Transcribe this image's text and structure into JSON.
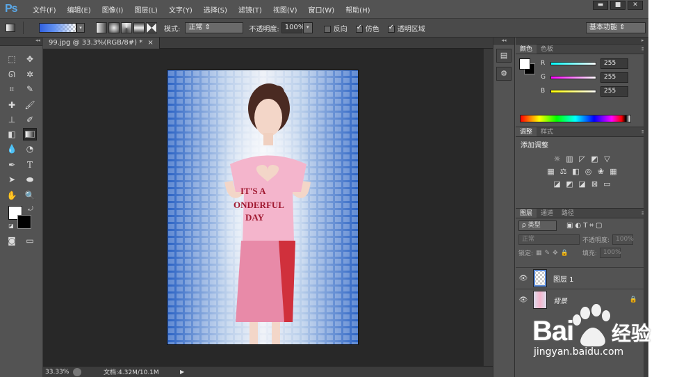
{
  "app": {
    "logo": "Ps"
  },
  "menu": [
    "文件(F)",
    "编辑(E)",
    "图像(I)",
    "图层(L)",
    "文字(Y)",
    "选择(S)",
    "滤镜(T)",
    "视图(V)",
    "窗口(W)",
    "帮助(H)"
  ],
  "window_controls": {
    "minimize": "▬",
    "maximize": "■",
    "close": "✕"
  },
  "options": {
    "mode_label": "模式:",
    "mode_value": "正常",
    "opacity_label": "不透明度:",
    "opacity_value": "100%",
    "reverse_label": "反向",
    "dither_label": "仿色",
    "transparency_label": "透明区域",
    "reverse_checked": false,
    "dither_checked": true,
    "transparency_checked": true,
    "workspace": "基本功能"
  },
  "document": {
    "tab_title": "99.jpg @ 33.3%(RGB/8#) *",
    "tab_close": "×",
    "zoom": "33.33%",
    "doc_info": "文档:4.32M/10.1M",
    "shirt_text": "IT'S A\nONDERFUL\nDAY"
  },
  "panels": {
    "color_tabs": [
      "颜色",
      "色板"
    ],
    "color": {
      "r_label": "R",
      "g_label": "G",
      "b_label": "B",
      "r": "255",
      "g": "255",
      "b": "255"
    },
    "adjust_tabs": [
      "调整",
      "样式"
    ],
    "adjust_title": "添加调整",
    "layers_tabs": [
      "图层",
      "通道",
      "路径"
    ],
    "layer_filter": "ρ 类型",
    "blend_mode": "正常",
    "opacity_label": "不透明度:",
    "opacity_value": "100%",
    "lock_label": "锁定:",
    "fill_label": "填充:",
    "fill_value": "100%",
    "layers": [
      {
        "name": "图层 1",
        "locked": false
      },
      {
        "name": "背景",
        "locked": true
      }
    ]
  },
  "watermark": {
    "brand_text": "Bai",
    "brand_tail": "经验",
    "url": "jingyan.baidu.com"
  },
  "colors": {
    "panel": "#535353",
    "dark": "#282828",
    "accent": "#5aa8e8",
    "baidu_blue": "#2932e1"
  }
}
